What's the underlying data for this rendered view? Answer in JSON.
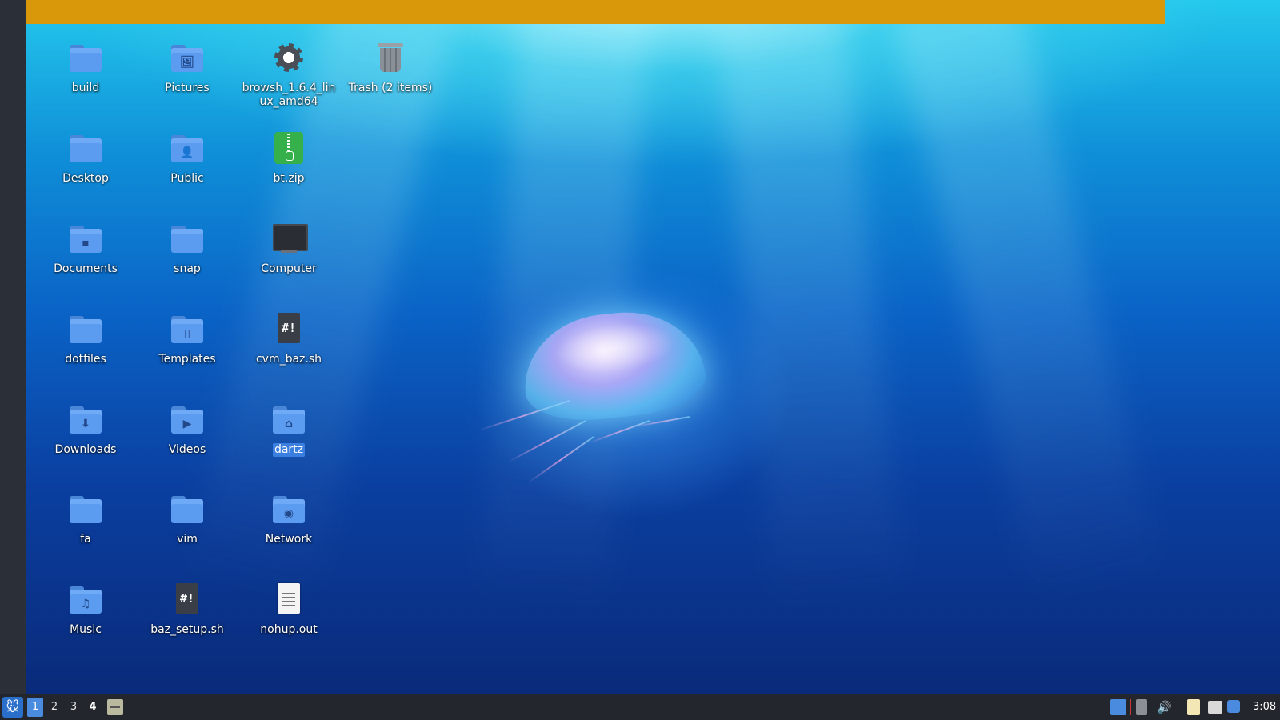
{
  "desktop": {
    "icons": [
      {
        "label": "build",
        "type": "folder",
        "emblem": ""
      },
      {
        "label": "Pictures",
        "type": "folder",
        "emblem": "🖼"
      },
      {
        "label": "browsh_1.6.4_linux_amd64",
        "type": "executable",
        "emblem": ""
      },
      {
        "label": "Trash (2 items)",
        "type": "trash",
        "emblem": ""
      },
      {
        "label": "Desktop",
        "type": "folder",
        "emblem": ""
      },
      {
        "label": "Public",
        "type": "folder",
        "emblem": "👤"
      },
      {
        "label": "bt.zip",
        "type": "zip",
        "emblem": ""
      },
      {
        "label": "Documents",
        "type": "folder",
        "emblem": "▪"
      },
      {
        "label": "snap",
        "type": "folder",
        "emblem": ""
      },
      {
        "label": "Computer",
        "type": "computer",
        "emblem": ""
      },
      {
        "label": "dotfiles",
        "type": "folder",
        "emblem": ""
      },
      {
        "label": "Templates",
        "type": "folder",
        "emblem": "▯"
      },
      {
        "label": "cvm_baz.sh",
        "type": "script",
        "emblem": "#!"
      },
      {
        "label": "Downloads",
        "type": "folder",
        "emblem": "⬇"
      },
      {
        "label": "Videos",
        "type": "folder",
        "emblem": "▶"
      },
      {
        "label": "dartz",
        "type": "folder",
        "emblem": "⌂",
        "selected": true
      },
      {
        "label": "fa",
        "type": "folder",
        "emblem": ""
      },
      {
        "label": "vim",
        "type": "folder",
        "emblem": ""
      },
      {
        "label": "Network",
        "type": "folder",
        "emblem": "◉"
      },
      {
        "label": "Music",
        "type": "folder",
        "emblem": "♫"
      },
      {
        "label": "baz_setup.sh",
        "type": "script",
        "emblem": "#!"
      },
      {
        "label": "nohup.out",
        "type": "text",
        "emblem": ""
      }
    ]
  },
  "taskbar": {
    "menu_icon": "🐭",
    "workspaces": [
      "1",
      "2",
      "3",
      "4"
    ],
    "active_workspace": "1",
    "volume_icon": "🔊",
    "clock": "3:08"
  },
  "colors": {
    "top_bar": "#d9970a",
    "taskbar": "#23262c",
    "selection": "#3b7fe0",
    "folder": "#5b9bf0"
  }
}
